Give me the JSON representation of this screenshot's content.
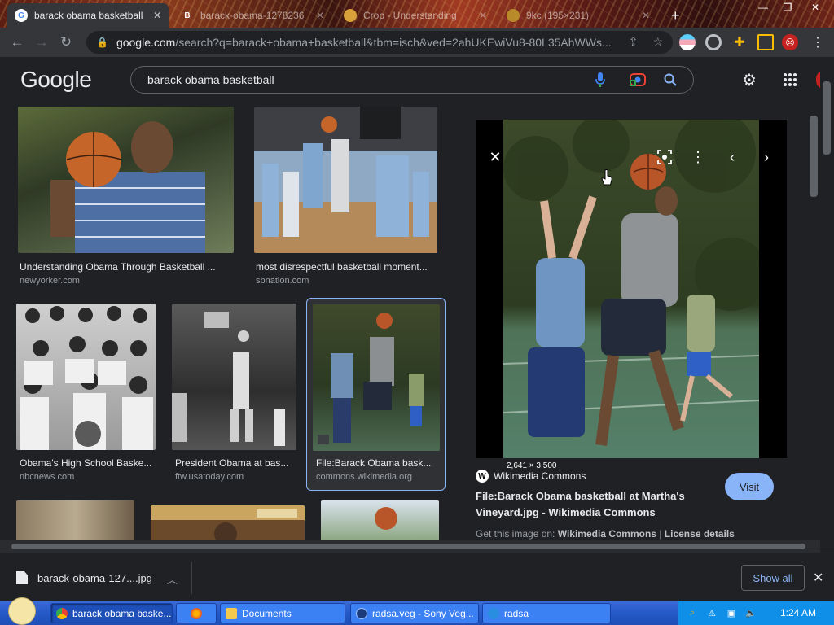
{
  "browser": {
    "tabs": [
      {
        "title": "barack obama basketball",
        "active": true,
        "favicon": "google-icon"
      },
      {
        "title": "barack-obama-1278236",
        "active": false,
        "favicon": "b-icon"
      },
      {
        "title": "Crop - Understanding",
        "active": false,
        "favicon": "crop-icon"
      },
      {
        "title": "9kc (195×231)",
        "active": false,
        "favicon": "image-icon"
      }
    ],
    "new_tab": "+",
    "url_host": "google.com",
    "url_path": "/search?q=barack+obama+basketball&tbm=isch&ved=2ahUKEwiVu8-80L35AhWWs..."
  },
  "google": {
    "logo": "Google",
    "query": "barack obama basketball"
  },
  "results": [
    {
      "caption": "Understanding Obama Through Basketball ...",
      "source": "newyorker.com",
      "selected": false
    },
    {
      "caption": "most disrespectful basketball moment...",
      "source": "sbnation.com",
      "selected": false
    },
    {
      "caption": "Obama's High School Baske...",
      "source": "nbcnews.com",
      "selected": false
    },
    {
      "caption": "President Obama at bas...",
      "source": "ftw.usatoday.com",
      "selected": false
    },
    {
      "caption": "File:Barack Obama bask...",
      "source": "commons.wikimedia.org",
      "selected": true
    }
  ],
  "preview": {
    "dimensions": "2,641 × 3,500",
    "site_name": "Wikimedia Commons",
    "title": "File:Barack Obama basketball at Martha's Vineyard.jpg - Wikimedia Commons",
    "visit_label": "Visit",
    "get_image_prefix": "Get this image on:",
    "get_image_site": "Wikimedia Commons",
    "get_image_separator": "|",
    "license_label": "License details"
  },
  "download": {
    "filename": "barack-obama-127....jpg",
    "show_all_label": "Show all"
  },
  "taskbar": {
    "items": [
      {
        "label": "barack obama baske...",
        "active": true
      },
      {
        "label": "",
        "active": false
      },
      {
        "label": "Documents",
        "active": false
      },
      {
        "label": "radsa.veg - Sony Veg...",
        "active": false
      },
      {
        "label": "radsa",
        "active": false
      }
    ],
    "clock": "1:24 AM"
  }
}
